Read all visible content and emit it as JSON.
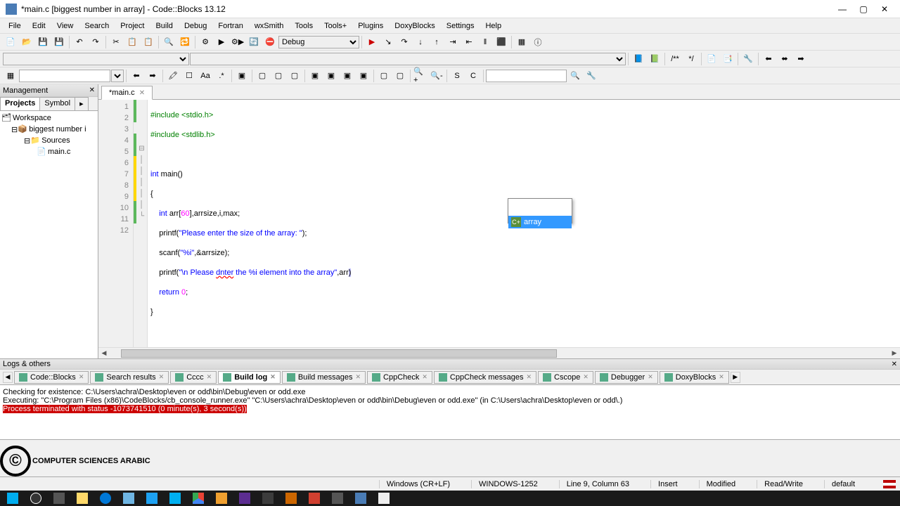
{
  "window": {
    "title": "*main.c [biggest number in array] - Code::Blocks 13.12"
  },
  "menu": [
    "File",
    "Edit",
    "View",
    "Search",
    "Project",
    "Build",
    "Debug",
    "Fortran",
    "wxSmith",
    "Tools",
    "Tools+",
    "Plugins",
    "DoxyBlocks",
    "Settings",
    "Help"
  ],
  "toolbar": {
    "build_target": "Debug"
  },
  "management": {
    "title": "Management",
    "tabs": [
      "Projects",
      "Symbol"
    ],
    "tree": {
      "workspace": "Workspace",
      "project": "biggest number i",
      "sources": "Sources",
      "file": "main.c"
    }
  },
  "editor": {
    "tab_name": "*main.c",
    "code": {
      "l1": "#include <stdio.h>",
      "l2": "#include <stdlib.h>",
      "l3": "",
      "l4_a": "int",
      "l4_b": " main()",
      "l5": "{",
      "l6_a": "    int",
      "l6_b": " arr[",
      "l6_c": "60",
      "l6_d": "],arrsize,i,max;",
      "l7_a": "    printf(",
      "l7_b": "\"Please enter the size of the array: \"",
      "l7_c": ");",
      "l8_a": "    scanf(",
      "l8_b": "\"%i\"",
      "l8_c": ",&arrsize);",
      "l9_a": "    printf(",
      "l9_b": "\"\\n Please ",
      "l9_c": "dnter",
      "l9_d": " the %i element into the array\"",
      "l9_e": ",arr",
      "l9_f": ")",
      "l10_a": "    return ",
      "l10_b": "0",
      "l10_c": ";",
      "l11": "}",
      "l12": ""
    },
    "autocomplete": {
      "item": "array"
    }
  },
  "logs": {
    "title": "Logs & others",
    "tabs": [
      "Code::Blocks",
      "Search results",
      "Cccc",
      "Build log",
      "Build messages",
      "CppCheck",
      "CppCheck messages",
      "Cscope",
      "Debugger",
      "DoxyBlocks"
    ],
    "active_tab": "Build log",
    "content": {
      "l1": "Checking for existence: C:\\Users\\achra\\Desktop\\even or odd\\bin\\Debug\\even or odd.exe",
      "l2": "Executing: \"C:\\Program Files (x86)\\CodeBlocks/cb_console_runner.exe\" \"C:\\Users\\achra\\Desktop\\even or odd\\bin\\Debug\\even or odd.exe\"  (in C:\\Users\\achra\\Desktop\\even or odd\\.)",
      "l3": "Process terminated with status -1073741510 (0 minute(s), 3 second(s))"
    }
  },
  "status": {
    "eol": "Windows (CR+LF)",
    "encoding": "WINDOWS-1252",
    "position": "Line 9, Column 63",
    "mode": "Insert",
    "modified": "Modified",
    "rw": "Read/Write",
    "profile": "default"
  },
  "watermark": "COMPUTER SCIENCES ARABIC"
}
